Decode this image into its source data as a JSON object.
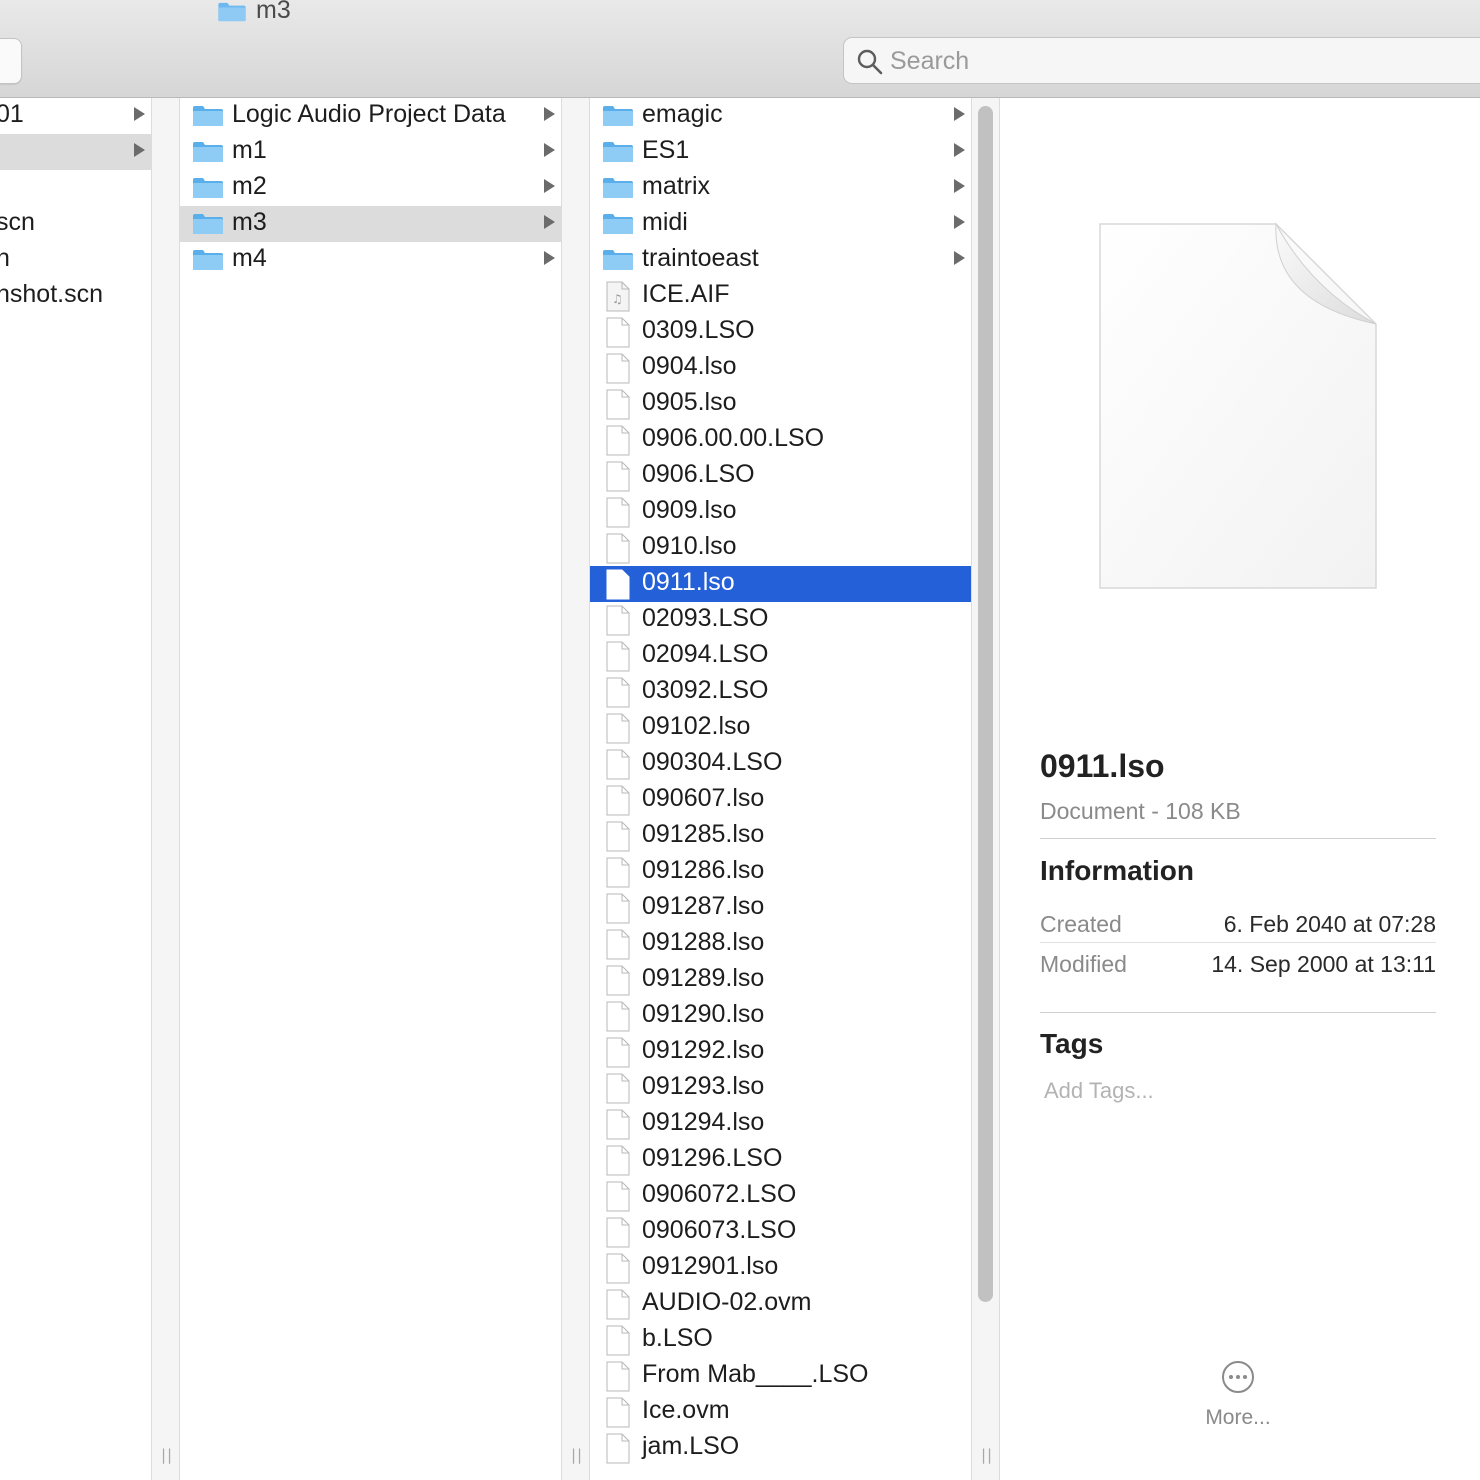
{
  "window": {
    "title": "m3"
  },
  "search": {
    "placeholder": "Search"
  },
  "column1": {
    "items": [
      {
        "label": "01",
        "has_children": true
      },
      {
        "label": "",
        "has_children": true,
        "selected": true
      },
      {
        "label": "",
        "has_children": false
      },
      {
        "label": "scn",
        "has_children": false
      },
      {
        "label": "n",
        "has_children": false
      },
      {
        "label": "nshot.scn",
        "has_children": false
      }
    ]
  },
  "column2": {
    "items": [
      {
        "label": "Logic Audio Project Data",
        "icon": "folder-icon",
        "has_children": true
      },
      {
        "label": "m1",
        "icon": "folder-icon",
        "has_children": true
      },
      {
        "label": "m2",
        "icon": "folder-icon",
        "has_children": true
      },
      {
        "label": "m3",
        "icon": "folder-icon",
        "has_children": true,
        "selected": true
      },
      {
        "label": "m4",
        "icon": "folder-icon",
        "has_children": true
      }
    ]
  },
  "column3": {
    "items": [
      {
        "label": "emagic",
        "icon": "folder-icon",
        "has_children": true
      },
      {
        "label": "ES1",
        "icon": "folder-icon",
        "has_children": true
      },
      {
        "label": "matrix",
        "icon": "folder-icon",
        "has_children": true
      },
      {
        "label": "midi",
        "icon": "folder-icon",
        "has_children": true
      },
      {
        "label": "traintoeast",
        "icon": "folder-icon",
        "has_children": true
      },
      {
        "label": "ICE.AIF",
        "icon": "audio-file-icon"
      },
      {
        "label": "0309.LSO",
        "icon": "document-icon"
      },
      {
        "label": "0904.lso",
        "icon": "document-icon"
      },
      {
        "label": "0905.lso",
        "icon": "document-icon"
      },
      {
        "label": "0906.00.00.LSO",
        "icon": "document-icon"
      },
      {
        "label": "0906.LSO",
        "icon": "document-icon"
      },
      {
        "label": "0909.lso",
        "icon": "document-icon"
      },
      {
        "label": "0910.lso",
        "icon": "document-icon"
      },
      {
        "label": "0911.lso",
        "icon": "document-icon",
        "selected": true
      },
      {
        "label": "02093.LSO",
        "icon": "document-icon"
      },
      {
        "label": "02094.LSO",
        "icon": "document-icon"
      },
      {
        "label": "03092.LSO",
        "icon": "document-icon"
      },
      {
        "label": "09102.lso",
        "icon": "document-icon"
      },
      {
        "label": "090304.LSO",
        "icon": "document-icon"
      },
      {
        "label": "090607.lso",
        "icon": "document-icon"
      },
      {
        "label": "091285.lso",
        "icon": "document-icon"
      },
      {
        "label": "091286.lso",
        "icon": "document-icon"
      },
      {
        "label": "091287.lso",
        "icon": "document-icon"
      },
      {
        "label": "091288.lso",
        "icon": "document-icon"
      },
      {
        "label": "091289.lso",
        "icon": "document-icon"
      },
      {
        "label": "091290.lso",
        "icon": "document-icon"
      },
      {
        "label": "091292.lso",
        "icon": "document-icon"
      },
      {
        "label": "091293.lso",
        "icon": "document-icon"
      },
      {
        "label": "091294.lso",
        "icon": "document-icon"
      },
      {
        "label": "091296.LSO",
        "icon": "document-icon"
      },
      {
        "label": "0906072.LSO",
        "icon": "document-icon"
      },
      {
        "label": "0906073.LSO",
        "icon": "document-icon"
      },
      {
        "label": "0912901.lso",
        "icon": "document-icon"
      },
      {
        "label": "AUDIO-02.ovm",
        "icon": "document-icon"
      },
      {
        "label": "b.LSO",
        "icon": "document-icon"
      },
      {
        "label": "From Mab____.LSO",
        "icon": "document-icon"
      },
      {
        "label": "Ice.ovm",
        "icon": "document-icon"
      },
      {
        "label": "jam.LSO",
        "icon": "document-icon"
      }
    ]
  },
  "preview": {
    "file_name": "0911.lso",
    "kind_size": "Document - 108 KB",
    "information_title": "Information",
    "created_label": "Created",
    "created_value": "6. Feb 2040 at 07:28",
    "modified_label": "Modified",
    "modified_value": "14. Sep 2000 at 13:11",
    "tags_title": "Tags",
    "tags_placeholder": "Add Tags...",
    "more_label": "More..."
  },
  "colors": {
    "selection_blue": "#2461d8",
    "selection_gray": "#dcdcdc",
    "folder_blue": "#6cb8ef"
  }
}
